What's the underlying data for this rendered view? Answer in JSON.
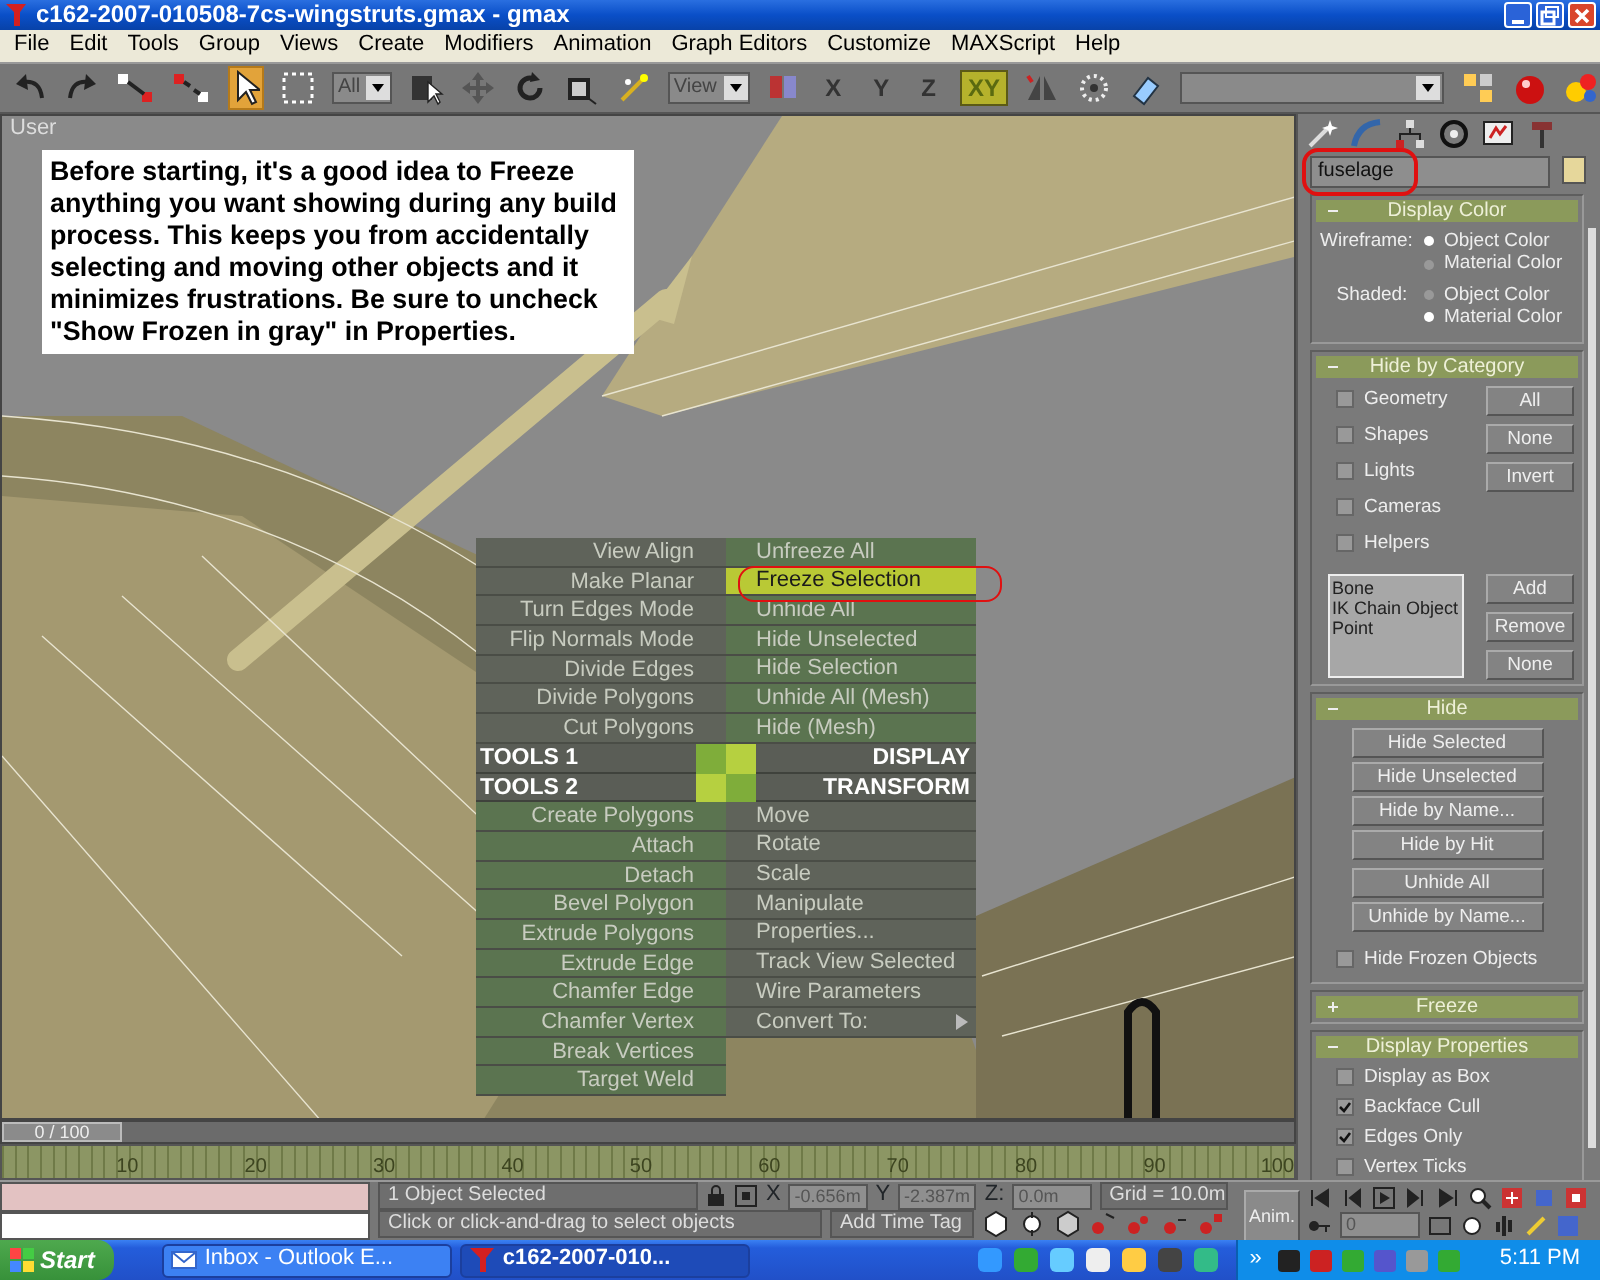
{
  "window": {
    "title": "c162-2007-010508-7cs-wingstruts.gmax - gmax"
  },
  "menu_bar": [
    "File",
    "Edit",
    "Tools",
    "Group",
    "Views",
    "Create",
    "Modifiers",
    "Animation",
    "Graph Editors",
    "Customize",
    "MAXScript",
    "Help"
  ],
  "toolbar": {
    "select_tool": {
      "selected": true
    },
    "selection_filter": "All",
    "reference_coordinate_system": "View",
    "axis_constraints": [
      {
        "label": "X",
        "selected": false
      },
      {
        "label": "Y",
        "selected": false
      },
      {
        "label": "Z",
        "selected": false
      },
      {
        "label": "XY",
        "selected": true
      }
    ]
  },
  "viewport": {
    "label": "User",
    "note": "Before starting, it's a good idea to Freeze anything you want showing during any build process.  This keeps you from accidentally selecting and moving other objects and it minimizes frustrations.  Be sure to uncheck \"Show Frozen in gray\" in Properties.",
    "quad_menu": {
      "upper_left": [
        {
          "label": "View Align",
          "selected": false
        },
        {
          "label": "Make Planar",
          "selected": false
        },
        {
          "label": "Turn Edges Mode",
          "selected": false
        },
        {
          "label": "Flip Normals Mode",
          "selected": false
        },
        {
          "label": "Divide Edges",
          "selected": false
        },
        {
          "label": "Divide Polygons",
          "selected": false
        },
        {
          "label": "Cut Polygons",
          "selected": false
        }
      ],
      "upper_right": [
        {
          "label": "Unfreeze All",
          "selected": false
        },
        {
          "label": "Freeze Selection",
          "selected": true
        },
        {
          "label": "Unhide All",
          "selected": false
        },
        {
          "label": "Hide Unselected",
          "selected": false
        },
        {
          "label": "Hide Selection",
          "selected": false
        },
        {
          "label": "Unhide All (Mesh)",
          "selected": false
        },
        {
          "label": "Hide (Mesh)",
          "selected": false
        }
      ],
      "left_headers": [
        "TOOLS 1",
        "TOOLS 2"
      ],
      "right_headers": [
        "DISPLAY",
        "TRANSFORM"
      ],
      "lower_left": [
        {
          "label": "Create Polygons",
          "selected": false
        },
        {
          "label": "Attach",
          "selected": false
        },
        {
          "label": "Detach",
          "selected": false
        },
        {
          "label": "Bevel Polygon",
          "selected": false
        },
        {
          "label": "Extrude Polygons",
          "selected": false
        },
        {
          "label": "Extrude Edge",
          "selected": false
        },
        {
          "label": "Chamfer Edge",
          "selected": false
        },
        {
          "label": "Chamfer Vertex",
          "selected": false
        },
        {
          "label": "Break Vertices",
          "selected": false
        },
        {
          "label": "Target Weld",
          "selected": false
        }
      ],
      "lower_right": [
        {
          "label": "Move",
          "selected": false,
          "submenu": false
        },
        {
          "label": "Rotate",
          "selected": false,
          "submenu": false
        },
        {
          "label": "Scale",
          "selected": false,
          "submenu": false
        },
        {
          "label": "Manipulate",
          "selected": false,
          "submenu": false
        },
        {
          "label": "Properties...",
          "selected": false,
          "submenu": false
        },
        {
          "label": "Track View Selected",
          "selected": false,
          "submenu": false
        },
        {
          "label": "Wire Parameters",
          "selected": false,
          "submenu": false
        },
        {
          "label": "Convert To:",
          "selected": false,
          "submenu": true
        }
      ]
    }
  },
  "time_slider": {
    "label": "0 / 100",
    "level": 0
  },
  "ruler_labels": [
    "10",
    "20",
    "30",
    "40",
    "50",
    "60",
    "70",
    "80",
    "90",
    "100"
  ],
  "command_panel": {
    "object_name": "fuselage",
    "rollouts": [
      {
        "kind": "display_color",
        "title": "Display Color",
        "expanded": true,
        "groups": [
          {
            "label": "Wireframe:",
            "options": [
              {
                "label": "Object Color",
                "selected": true
              },
              {
                "label": "Material Color",
                "selected": false
              }
            ]
          },
          {
            "label": "Shaded:",
            "options": [
              {
                "label": "Object Color",
                "selected": false
              },
              {
                "label": "Material Color",
                "selected": true
              }
            ]
          }
        ]
      },
      {
        "kind": "hide_by_category",
        "title": "Hide by Category",
        "expanded": true,
        "checkboxes": [
          {
            "label": "Geometry",
            "checked": false
          },
          {
            "label": "Shapes",
            "checked": false
          },
          {
            "label": "Lights",
            "checked": false
          },
          {
            "label": "Cameras",
            "checked": false
          },
          {
            "label": "Helpers",
            "checked": false
          }
        ],
        "buttons": [
          "All",
          "None",
          "Invert"
        ],
        "list_items": [
          "Bone",
          "IK Chain Object",
          "Point"
        ],
        "list_buttons": [
          "Add",
          "Remove",
          "None"
        ]
      },
      {
        "kind": "hide",
        "title": "Hide",
        "expanded": true,
        "buttons": [
          "Hide Selected",
          "Hide Unselected",
          "Hide by Name...",
          "Hide by Hit"
        ],
        "unhide_buttons": [
          "Unhide All",
          "Unhide by Name..."
        ],
        "checkboxes": [
          {
            "label": "Hide Frozen Objects",
            "checked": false
          }
        ]
      },
      {
        "kind": "freeze",
        "title": "Freeze",
        "expanded": false
      },
      {
        "kind": "display_properties",
        "title": "Display Properties",
        "expanded": true,
        "checkboxes": [
          {
            "label": "Display as Box",
            "checked": false
          },
          {
            "label": "Backface Cull",
            "checked": true
          },
          {
            "label": "Edges Only",
            "checked": true
          },
          {
            "label": "Vertex Ticks",
            "checked": false
          }
        ]
      }
    ]
  },
  "status_bar": {
    "selection": "1 Object Selected",
    "prompt": "Click or click-and-drag to select objects",
    "coordinates": [
      {
        "label": "X",
        "value": "-0.656m"
      },
      {
        "label": "Y",
        "value": "-2.387m"
      },
      {
        "label": "Z:",
        "value": "0.0m"
      }
    ],
    "grid": "Grid = 10.0m",
    "time_tag": "Add Time Tag",
    "anim_button": "Anim.",
    "current_frame": "0"
  },
  "taskbar": {
    "start": "Start",
    "tasks": [
      {
        "label": "Inbox - Outlook E...",
        "selected": false
      },
      {
        "label": "c162-2007-010...",
        "selected": true
      }
    ],
    "overflow": "»",
    "clock": "5:11 PM"
  }
}
